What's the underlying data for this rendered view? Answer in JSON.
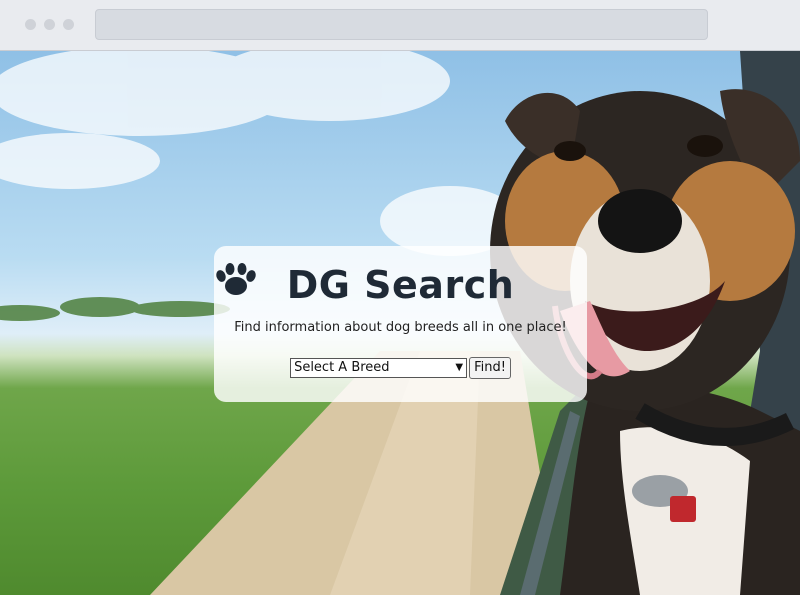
{
  "browser": {
    "window_controls": [
      "close-dot",
      "minimize-dot",
      "maximize-dot"
    ],
    "address_bar": ""
  },
  "hero": {
    "title_before": "D",
    "title_icon": "paw-icon",
    "title_after": "G Search",
    "subtitle": "Find information about dog breeds all in one place!",
    "breed_select": {
      "selected": "Select A Breed"
    },
    "find_button": "Find!"
  },
  "colors": {
    "title": "#1f2a36",
    "card": "rgba(255,255,255,0.82)"
  }
}
